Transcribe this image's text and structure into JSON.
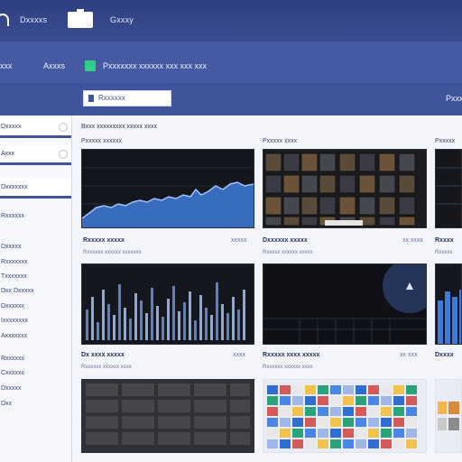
{
  "topbar": {
    "items": [
      {
        "label": "Dxxxxs"
      },
      {
        "label": "Gxxxy"
      }
    ]
  },
  "navbar": {
    "left_label": "xxx",
    "item_label": "Axxxs",
    "title": "Pxxxxxxx xxxxxx xxx xxx xxx"
  },
  "toolbar": {
    "search_label": "Rxxxxxx",
    "right_label": "Pxxx"
  },
  "sidebar": {
    "items": [
      {
        "label": "Dxxxxx"
      },
      {
        "label": "Axxx"
      },
      {
        "label": "Dxxxxxxx"
      }
    ],
    "links": [
      {
        "label": "Rxxxxxx"
      },
      {
        "label": "Dxxxxx"
      },
      {
        "label": "Rxxxxxxx"
      },
      {
        "label": "Txxxxxxx"
      },
      {
        "label": "Dxx Dxxxxx"
      },
      {
        "label": "Dxxxxxx"
      },
      {
        "label": "Ixxxxxxxx"
      },
      {
        "label": "Axxxxxxx"
      },
      {
        "label": "Rxxxxxx"
      },
      {
        "label": "Cxxxxxx"
      },
      {
        "label": "Dxxxxx"
      },
      {
        "label": "Dxx"
      }
    ]
  },
  "main": {
    "header": "Bxxx xxxxxxxxx xxxxx xxxx",
    "cards": [
      {
        "label": "Pxxxxx xxxxxx",
        "title": "Rxxxxx xxxxx",
        "meta": "xxxxx",
        "sub": "Rxxxxxx xxxxxx xxxxxxx"
      },
      {
        "label": "Pxxxxx xxxx",
        "title": "Dxxxxxx xxxxx",
        "meta": "xx xxxx",
        "sub": "Rxxxxx xxxxxx xxxxx"
      },
      {
        "label": "Pxxxxx",
        "title": "Rxxxx",
        "meta": "",
        "sub": "Rxxxxx"
      },
      {
        "label": "",
        "title": "Dx xxxx xxxxx",
        "meta": "xxxx",
        "sub": "Rxxxxxx xxxxxx xxxx"
      },
      {
        "label": "",
        "title": "Rxxxxx xxxx xxxxx",
        "meta": "xx xxx",
        "sub": "Rxxxxxx xxxxxx xxxx"
      },
      {
        "label": "",
        "title": "Dxxxx",
        "meta": "",
        "sub": ""
      }
    ]
  },
  "colors": {
    "topbar": "#2e3f80",
    "accent": "#3f549b",
    "highlight": "#2fcf85",
    "chart_blue": "#3e7bd8"
  }
}
